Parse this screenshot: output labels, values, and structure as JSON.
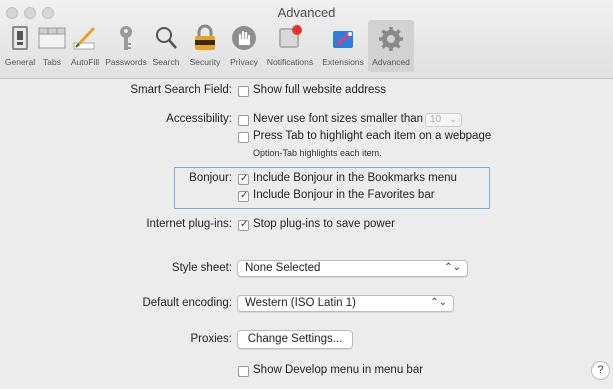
{
  "window": {
    "title": "Advanced"
  },
  "toolbar": {
    "items": [
      {
        "label": "General",
        "icon": "general-icon"
      },
      {
        "label": "Tabs",
        "icon": "tabs-icon"
      },
      {
        "label": "AutoFill",
        "icon": "autofill-icon"
      },
      {
        "label": "Passwords",
        "icon": "key-icon"
      },
      {
        "label": "Search",
        "icon": "search-icon"
      },
      {
        "label": "Security",
        "icon": "lock-icon"
      },
      {
        "label": "Privacy",
        "icon": "hand-icon"
      },
      {
        "label": "Notifications",
        "icon": "notifications-icon"
      },
      {
        "label": "Extensions",
        "icon": "puzzle-icon"
      },
      {
        "label": "Advanced",
        "icon": "gears-icon",
        "selected": true
      }
    ]
  },
  "settings": {
    "smart_search": {
      "label": "Smart Search Field:",
      "option": "Show full website address",
      "checked": false
    },
    "accessibility": {
      "label": "Accessibility:",
      "font_option": "Never use font sizes smaller than",
      "font_size": "10",
      "tab_option": "Press Tab to highlight each item on a webpage",
      "hint": "Option-Tab highlights each item."
    },
    "bonjour": {
      "label": "Bonjour:",
      "bookmarks_option": "Include Bonjour in the Bookmarks menu",
      "favorites_option": "Include Bonjour in the Favorites bar"
    },
    "plugins": {
      "label": "Internet plug-ins:",
      "option": "Stop plug-ins to save power"
    },
    "style_sheet": {
      "label": "Style sheet:",
      "value": "None Selected"
    },
    "encoding": {
      "label": "Default encoding:",
      "value": "Western (ISO Latin 1)"
    },
    "proxies": {
      "label": "Proxies:",
      "button": "Change Settings..."
    },
    "develop": {
      "option": "Show Develop menu in menu bar"
    },
    "help": {
      "label": "?"
    }
  },
  "colors": {
    "accent": "#7fa7d8",
    "background": "#ececec"
  }
}
